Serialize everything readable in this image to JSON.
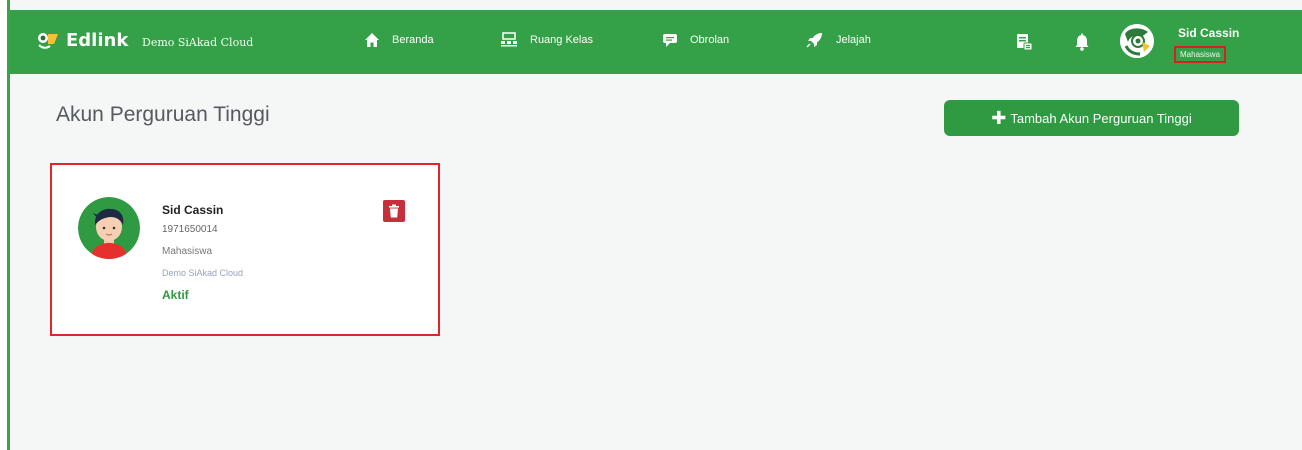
{
  "header": {
    "brand_small": "",
    "brand_name": "Edlink",
    "brand_sub": "Demo SiAkad Cloud",
    "nav": [
      {
        "label": "Beranda",
        "icon": "home-icon"
      },
      {
        "label": "Ruang Kelas",
        "icon": "classroom-icon"
      },
      {
        "label": "Obrolan",
        "icon": "chat-icon"
      },
      {
        "label": "Jelajah",
        "icon": "rocket-icon"
      }
    ],
    "icons": [
      "document-icon",
      "bell-icon"
    ],
    "user": {
      "name": "Sid Cassin",
      "role": "Mahasiswa"
    }
  },
  "main": {
    "title": "Akun Perguruan Tinggi",
    "add_button_label": "Tambah Akun Perguruan Tinggi",
    "accounts": [
      {
        "name": "Sid Cassin",
        "nim": "1971650014",
        "role": "Mahasiswa",
        "campus": "Demo SiAkad Cloud",
        "status": "Aktif"
      }
    ]
  },
  "colors": {
    "brand_green": "#34a047",
    "button_green": "#2f9a42",
    "delete_red": "#c6303a",
    "highlight_red": "#e0252b"
  }
}
